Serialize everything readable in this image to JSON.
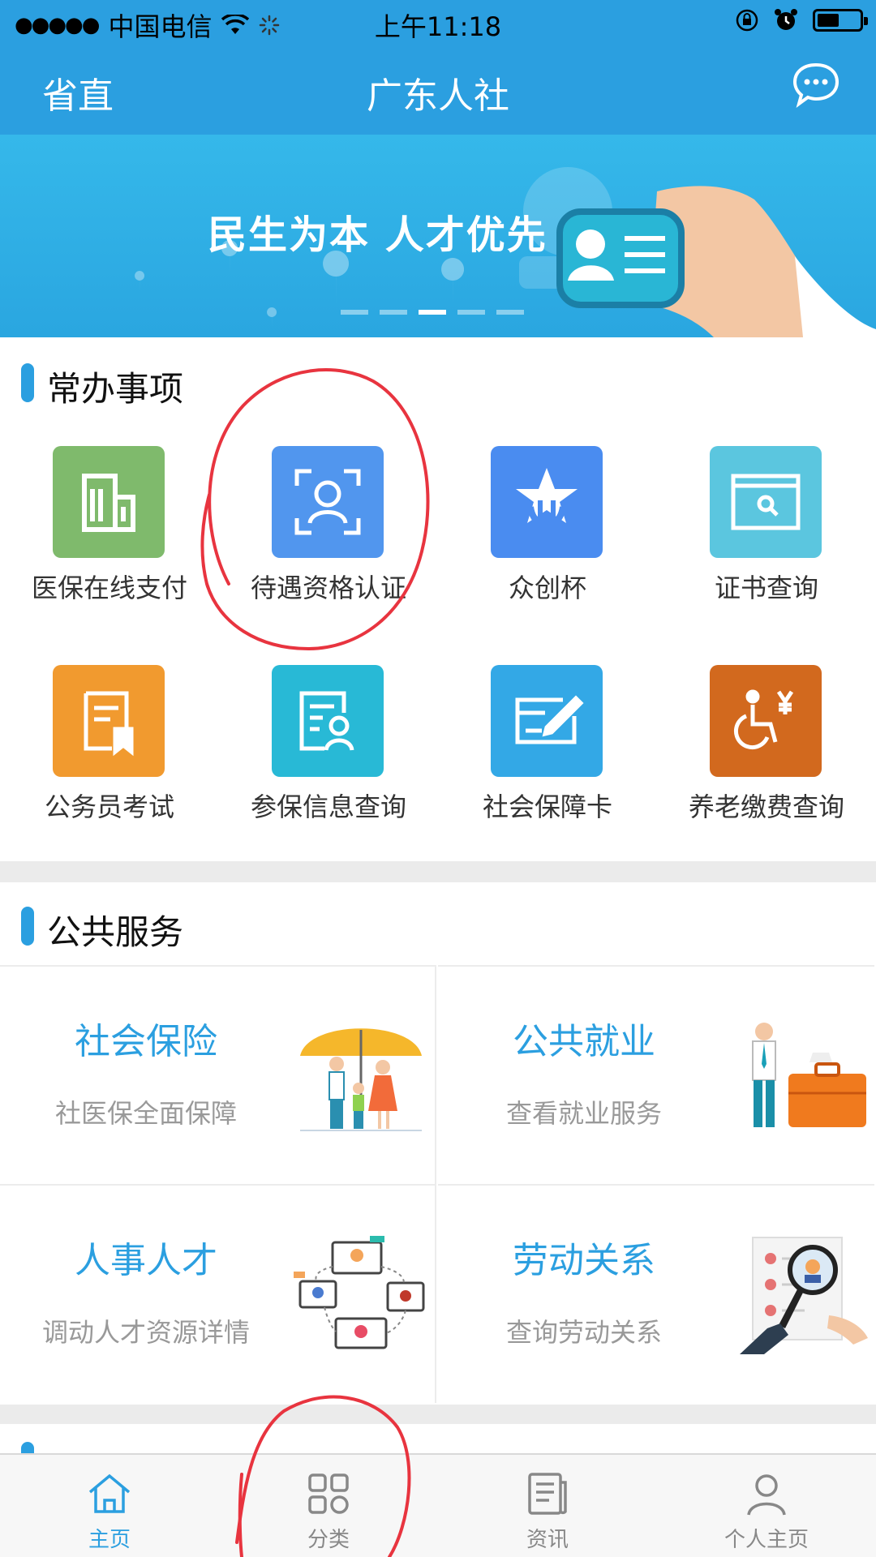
{
  "status_bar": {
    "signal": "●●●●●",
    "carrier": "中国电信",
    "time": "上午11:18"
  },
  "header": {
    "region": "省直",
    "title": "广东人社",
    "message_icon": "chat-bubble-icon"
  },
  "banner": {
    "slogan": "民生为本 人才优先",
    "active_page": 3,
    "page_count": 5
  },
  "common": {
    "title": "常办事项",
    "items": [
      {
        "label": "医保在线支付",
        "icon": "building-icon",
        "color": "#7fba6c"
      },
      {
        "label": "待遇资格认证",
        "icon": "face-scan-icon",
        "color": "#5196ee"
      },
      {
        "label": "众创杯",
        "icon": "star-cup-icon",
        "color": "#4a8cf0"
      },
      {
        "label": "证书查询",
        "icon": "search-window-icon",
        "color": "#5bc6df"
      },
      {
        "label": "公务员考试",
        "icon": "exam-document-icon",
        "color": "#f19a2f"
      },
      {
        "label": "参保信息查询",
        "icon": "person-document-icon",
        "color": "#28b9d6"
      },
      {
        "label": "社会保障卡",
        "icon": "card-pen-icon",
        "color": "#33a8e6"
      },
      {
        "label": "养老缴费查询",
        "icon": "wheelchair-yen-icon",
        "color": "#d2691e"
      }
    ]
  },
  "public_services": {
    "title": "公共服务",
    "cards": [
      {
        "title": "社会保险",
        "subtitle": "社医保全面保障",
        "art": "family-umbrella-illustration"
      },
      {
        "title": "公共就业",
        "subtitle": "查看就业服务",
        "art": "worker-briefcase-illustration"
      },
      {
        "title": "人事人才",
        "subtitle": "调动人才资源详情",
        "art": "talent-network-illustration"
      },
      {
        "title": "劳动关系",
        "subtitle": "查询劳动关系",
        "art": "magnifier-resume-illustration"
      }
    ]
  },
  "tabbar": {
    "tabs": [
      {
        "label": "主页",
        "icon": "home-icon",
        "active": true
      },
      {
        "label": "分类",
        "icon": "grid-icon",
        "active": false
      },
      {
        "label": "资讯",
        "icon": "news-icon",
        "active": false
      },
      {
        "label": "个人主页",
        "icon": "person-icon",
        "active": false
      }
    ]
  },
  "colors": {
    "brand": "#2b9fe0",
    "annotation": "#e8343f"
  }
}
